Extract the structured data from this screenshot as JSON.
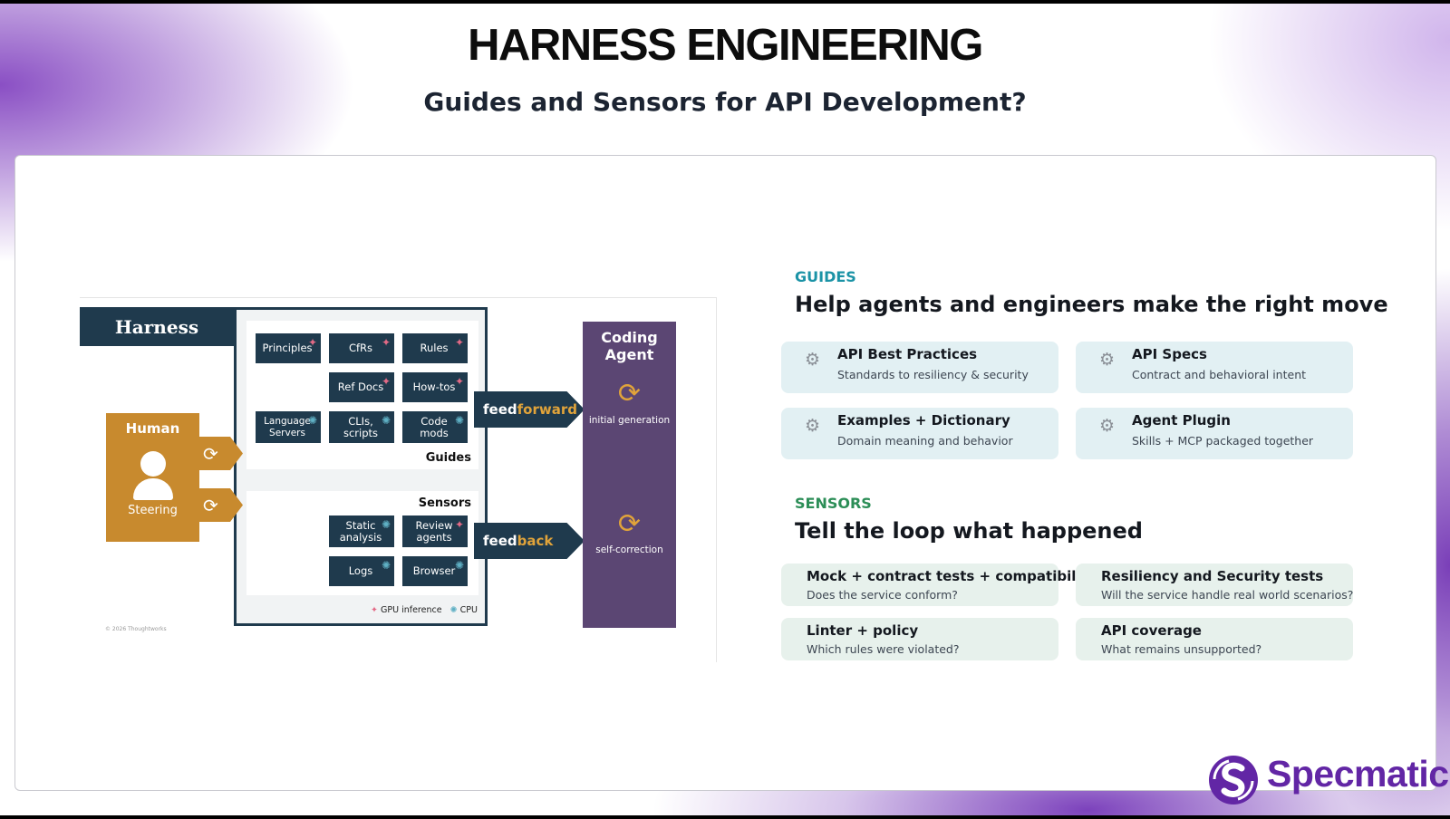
{
  "header": {
    "title": "HARNESS ENGINEERING",
    "subtitle": "Guides and Sensors for API Development?"
  },
  "diagram": {
    "harness_label": "Harness",
    "guides_chips": [
      "Principles",
      "CfRs",
      "Rules",
      "Ref Docs",
      "How-tos",
      "Language Servers",
      "CLIs, scripts",
      "Code mods"
    ],
    "guides_label": "Guides",
    "sensors_label": "Sensors",
    "sensors_chips": [
      "Static analysis",
      "Review agents",
      "Logs",
      "Browser"
    ],
    "human_label": "Human",
    "steering_label": "Steering",
    "feedforward": {
      "a": "feed",
      "b": "forward"
    },
    "feedback": {
      "a": "feed",
      "b": "back"
    },
    "agent_title": "Coding Agent",
    "initial_generation": "initial generation",
    "self_correction": "self-correction",
    "legend_gpu": "GPU inference",
    "legend_cpu": "CPU",
    "copyright": "© 2026 Thoughtworks",
    "colors": {
      "navy": "#1f3a4d",
      "ochre": "#c88a2e",
      "purple": "#5b4673",
      "gpu": "#e36a86",
      "cpu": "#5fb0c4"
    }
  },
  "guides": {
    "label": "GUIDES",
    "heading": "Help agents and engineers make the right move",
    "color": "#1b93a6",
    "items": [
      {
        "title": "API Best Practices",
        "desc": "Standards to resiliency & security"
      },
      {
        "title": "API Specs",
        "desc": "Contract and behavioral intent"
      },
      {
        "title": "Examples + Dictionary",
        "desc": "Domain meaning and behavior"
      },
      {
        "title": "Agent Plugin",
        "desc": "Skills + MCP packaged together"
      }
    ]
  },
  "sensors": {
    "label": "SENSORS",
    "heading": "Tell the loop what happened",
    "color": "#2c8e57",
    "items": [
      {
        "title": "Mock + contract tests + compatibility",
        "desc": "Does the service conform?"
      },
      {
        "title": "Resiliency and Security tests",
        "desc": "Will the service handle real world scenarios?"
      },
      {
        "title": "Linter + policy",
        "desc": "Which rules were violated?"
      },
      {
        "title": "API coverage",
        "desc": "What remains unsupported?"
      }
    ]
  },
  "logo": {
    "text": "Specmatic",
    "color": "#6226a5"
  }
}
